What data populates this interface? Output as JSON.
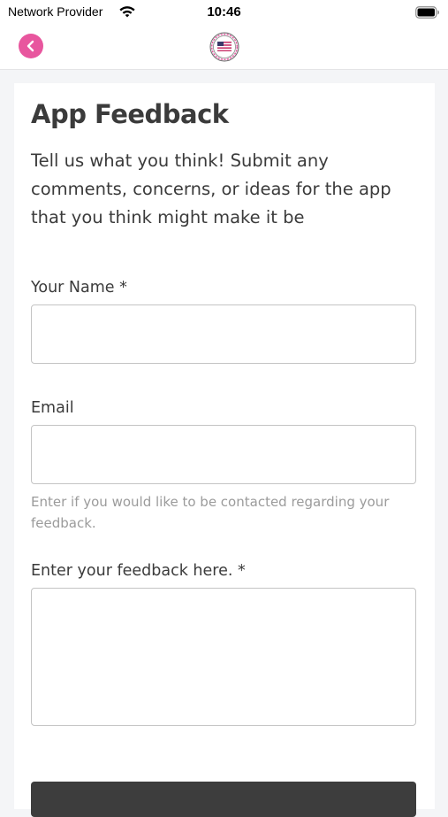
{
  "status_bar": {
    "carrier": "Network Provider",
    "time": "10:46",
    "wifi_icon": "wifi-icon",
    "battery_icon": "battery-icon"
  },
  "nav": {
    "back_icon": "chevron-left-icon",
    "logo_icon": "flag-seal-logo",
    "accent_color": "#e8569e"
  },
  "form": {
    "title": "App Feedback",
    "intro": "Tell us what you think! Submit any comments, concerns, or ideas for the app that you think might make it be",
    "name_label": "Your Name *",
    "name_value": "",
    "email_label": "Email",
    "email_value": "",
    "email_help": "Enter if you would like to be contacted regarding your feedback.",
    "feedback_label": "Enter your feedback here. *",
    "feedback_value": "",
    "submit_color": "#3d3d3d"
  }
}
